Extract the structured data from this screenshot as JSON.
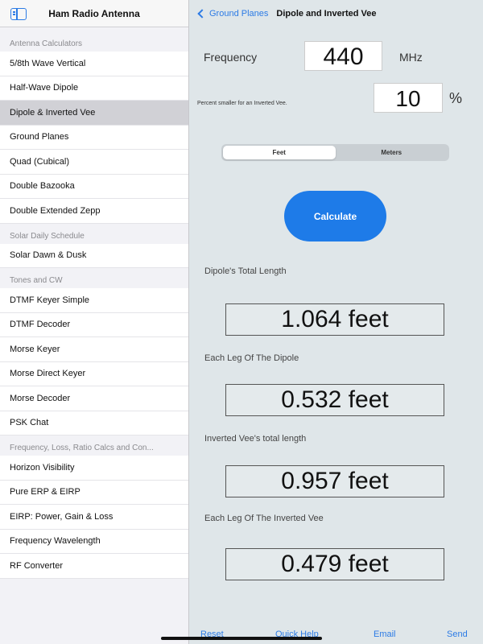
{
  "sidebar": {
    "title": "Ham Radio Antenna",
    "sections": [
      {
        "header": "Antenna Calculators",
        "items": [
          "5/8th Wave Vertical",
          "Half-Wave Dipole",
          "Dipole & Inverted Vee",
          "Ground Planes",
          "Quad (Cubical)",
          "Double Bazooka",
          "Double Extended Zepp"
        ]
      },
      {
        "header": "Solar Daily Schedule",
        "items": [
          "Solar Dawn & Dusk"
        ]
      },
      {
        "header": "Tones and CW",
        "items": [
          "DTMF Keyer Simple",
          "DTMF Decoder",
          "Morse Keyer",
          "Morse Direct Keyer",
          "Morse Decoder",
          "PSK Chat"
        ]
      },
      {
        "header": "Frequency, Loss, Ratio Calcs and Con...",
        "items": [
          "Horizon Visibility",
          "Pure ERP & EIRP",
          "EIRP: Power, Gain & Loss",
          "Frequency Wavelength",
          "RF Converter"
        ]
      }
    ],
    "selected": "Dipole & Inverted Vee"
  },
  "nav": {
    "back_label": "Ground Planes",
    "title": "Dipole and Inverted Vee"
  },
  "form": {
    "frequency_label": "Frequency",
    "frequency_value": "440",
    "frequency_unit": "MHz",
    "percent_label": "Percent smaller for an Inverted Vee.",
    "percent_value": "10",
    "percent_unit": "%",
    "units": [
      "Feet",
      "Meters"
    ],
    "selected_unit": "Feet",
    "calculate_label": "Calculate"
  },
  "results": [
    {
      "label": "Dipole's Total Length",
      "value": "1.064 feet"
    },
    {
      "label": "Each Leg Of The Dipole",
      "value": "0.532 feet"
    },
    {
      "label": "Inverted Vee's total length",
      "value": "0.957 feet"
    },
    {
      "label": "Each Leg Of The Inverted Vee",
      "value": "0.479 feet"
    }
  ],
  "footer": {
    "reset": "Reset",
    "quick_help": "Quick Help",
    "email": "Email",
    "send": "Send"
  },
  "colors": {
    "accent": "#1e7be8",
    "main_bg": "#dfe6e9",
    "selected_row": "#d1d1d6"
  }
}
